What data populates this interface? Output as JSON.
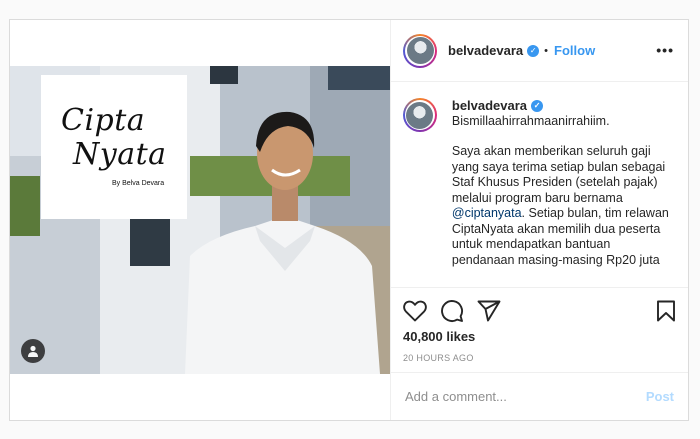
{
  "post": {
    "logo": {
      "line1": "Cipta",
      "line2": "Nyata",
      "byline": "By Belva Devara"
    },
    "tag_icon": "user-tag-icon"
  },
  "header": {
    "username": "belvadevara",
    "verified_icon": "verified-badge-icon",
    "separator": "•",
    "follow_label": "Follow",
    "more_label": "•••"
  },
  "caption": {
    "username": "belvadevara",
    "paragraphs": [
      "Bismillaahirrahmaanirrahiim.",
      "Saya akan memberikan seluruh gaji yang saya terima setiap bulan sebagai Staf Khusus Presiden (setelah pajak) melalui program baru bernama",
      "@ciptanyata",
      ". Setiap bulan, tim relawan CiptaNyata akan memilih dua peserta untuk mendapatkan bantuan pendanaan masing-masing Rp20 juta"
    ]
  },
  "actions": {
    "icons": [
      "heart-icon",
      "comment-icon",
      "share-icon",
      "bookmark-icon"
    ],
    "likes": "40,800 likes",
    "time": "20 HOURS AGO"
  },
  "comment_box": {
    "placeholder": "Add a comment...",
    "post_label": "Post"
  },
  "colors": {
    "accent": "#3897f0",
    "text": "#262626",
    "muted": "#8e8e8e",
    "post_disabled": "#b3dbff"
  }
}
